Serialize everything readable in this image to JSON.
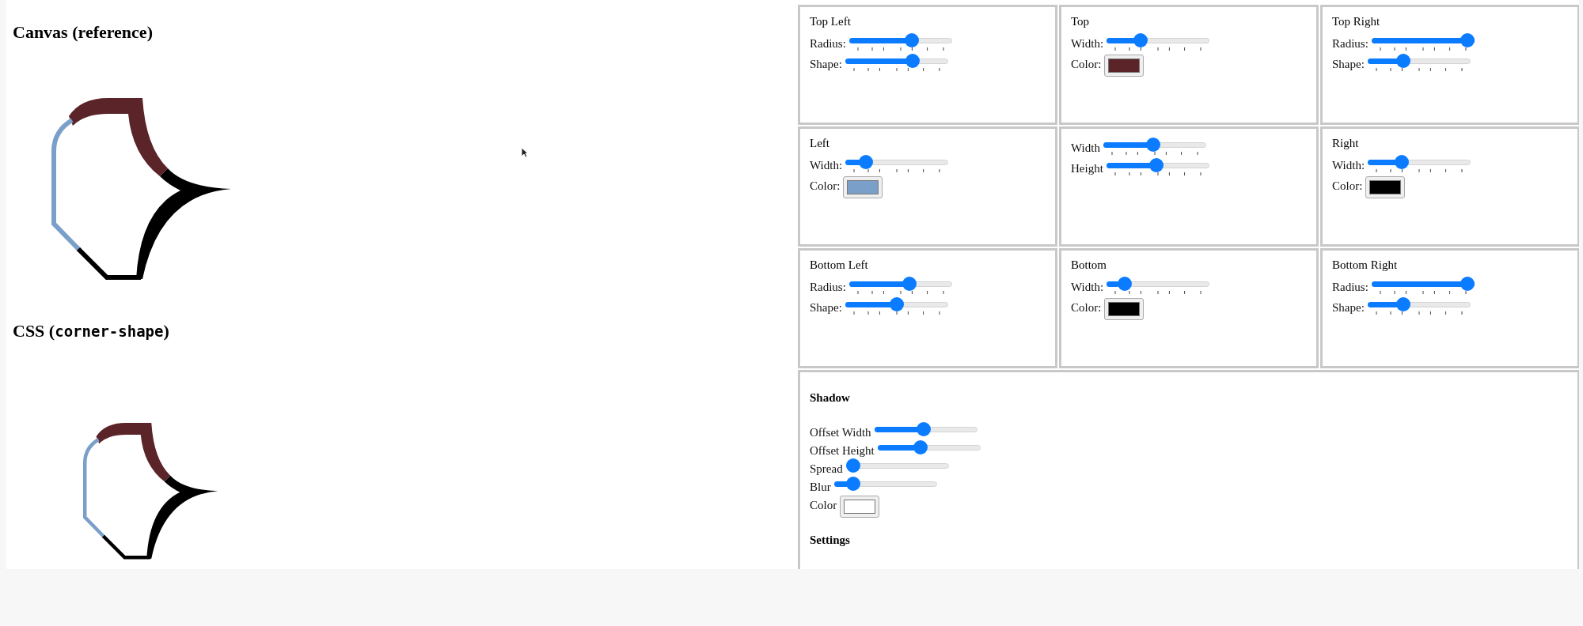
{
  "canvas_section": {
    "heading": "Canvas (reference)"
  },
  "css_section": {
    "heading_text": "CSS (",
    "heading_code": "corner-shape",
    "heading_end": ")"
  },
  "panels": [
    {
      "title": "Top Left",
      "controls": [
        {
          "kind": "slider",
          "label": "Radius:",
          "level": 0.63,
          "ticks": true
        },
        {
          "kind": "slider",
          "label": "Shape:",
          "level": 0.68,
          "ticks": true
        }
      ]
    },
    {
      "title": "Top",
      "controls": [
        {
          "kind": "slider",
          "label": "Width:",
          "level": 0.3,
          "ticks": true
        },
        {
          "kind": "color",
          "label": "Color:",
          "color": "#5a2428"
        }
      ]
    },
    {
      "title": "Top Right",
      "controls": [
        {
          "kind": "slider",
          "label": "Radius:",
          "level": 1.0,
          "ticks": true
        },
        {
          "kind": "slider",
          "label": "Shape:",
          "level": 0.32,
          "ticks": true
        }
      ]
    },
    {
      "title": "Left",
      "controls": [
        {
          "kind": "slider",
          "label": "Width:",
          "level": 0.15,
          "ticks": true
        },
        {
          "kind": "color",
          "label": "Color:",
          "color": "#7a9fc9"
        }
      ]
    },
    {
      "controls": [
        {
          "kind": "slider",
          "label": "Width",
          "level": 0.48,
          "ticks": true
        },
        {
          "kind": "slider",
          "label": "Height",
          "level": 0.48,
          "ticks": true
        }
      ]
    },
    {
      "title": "Right",
      "controls": [
        {
          "kind": "slider",
          "label": "Width:",
          "level": 0.3,
          "ticks": true
        },
        {
          "kind": "color",
          "label": "Color:",
          "color": "#000000"
        }
      ]
    },
    {
      "title": "Bottom Left",
      "controls": [
        {
          "kind": "slider",
          "label": "Radius:",
          "level": 0.6,
          "ticks": true
        },
        {
          "kind": "slider",
          "label": "Shape:",
          "level": 0.5,
          "ticks": true
        }
      ]
    },
    {
      "title": "Bottom",
      "controls": [
        {
          "kind": "slider",
          "label": "Width:",
          "level": 0.12,
          "ticks": true
        },
        {
          "kind": "color",
          "label": "Color:",
          "color": "#000000"
        }
      ]
    },
    {
      "title": "Bottom Right",
      "controls": [
        {
          "kind": "slider",
          "label": "Radius:",
          "level": 1.0,
          "ticks": true
        },
        {
          "kind": "slider",
          "label": "Shape:",
          "level": 0.32,
          "ticks": true
        }
      ]
    }
  ],
  "shadow": {
    "heading": "Shadow",
    "controls": [
      {
        "kind": "slider",
        "label": "Offset Width",
        "level": 0.48,
        "ticks": false
      },
      {
        "kind": "slider",
        "label": "Offset Height",
        "level": 0.4,
        "ticks": false
      },
      {
        "kind": "slider",
        "label": "Spread",
        "level": 0.0,
        "ticks": false
      },
      {
        "kind": "slider",
        "label": "Blur",
        "level": 0.14,
        "ticks": false
      },
      {
        "kind": "color",
        "label": "Color",
        "color": "#ffffff"
      }
    ]
  },
  "settings": {
    "heading": "Settings"
  }
}
